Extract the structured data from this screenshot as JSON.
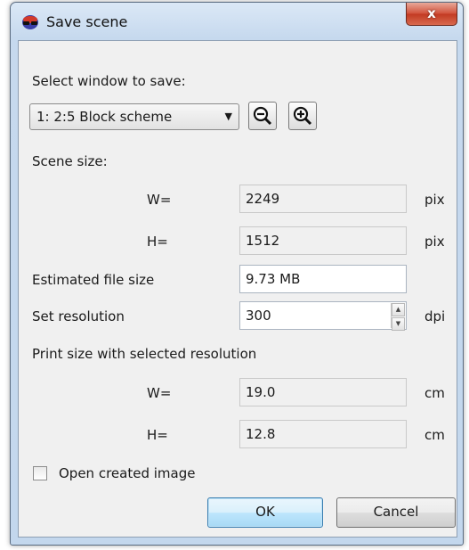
{
  "window": {
    "title": "Save scene",
    "close_glyph": "x"
  },
  "select_window": {
    "label": "Select window to save:",
    "selected": "1: 2:5 Block scheme",
    "zoom_out_icon": "zoom-out-icon",
    "zoom_in_icon": "zoom-in-icon"
  },
  "scene_size": {
    "label": "Scene size:",
    "w_label": "W=",
    "w_value": "2249",
    "w_unit": "pix",
    "h_label": "H=",
    "h_value": "1512",
    "h_unit": "pix"
  },
  "file_size": {
    "label": "Estimated file size",
    "value": "9.73 MB"
  },
  "resolution": {
    "label": "Set resolution",
    "value": "300",
    "unit": "dpi"
  },
  "print_size": {
    "label": "Print size with selected resolution",
    "w_label": "W=",
    "w_value": "19.0",
    "w_unit": "cm",
    "h_label": "H=",
    "h_value": "12.8",
    "h_unit": "cm"
  },
  "open_image": {
    "label": "Open created image",
    "checked": false
  },
  "buttons": {
    "ok": "OK",
    "cancel": "Cancel"
  },
  "colors": {
    "title_bar": "#c6d9ee",
    "close_button": "#c23a22",
    "default_button": "#bee6fd"
  }
}
